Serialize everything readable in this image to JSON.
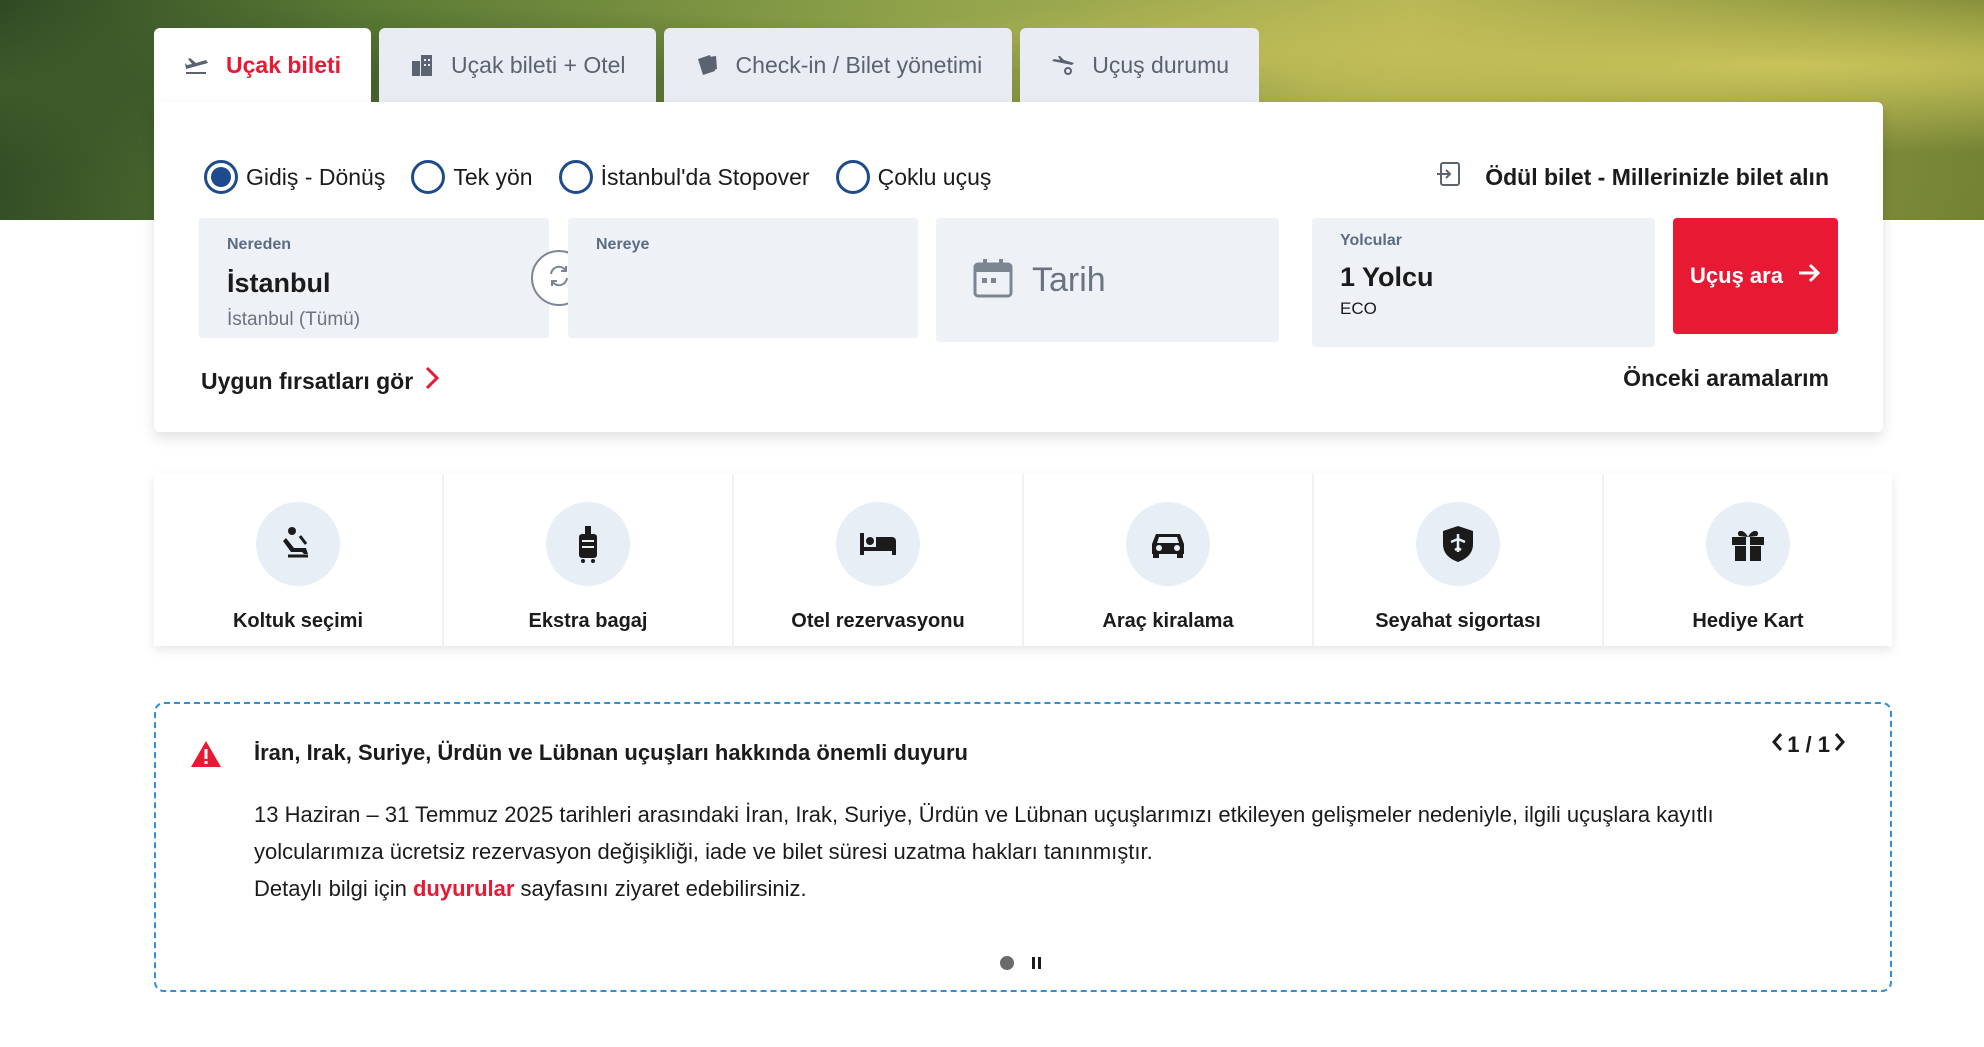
{
  "tabs": [
    {
      "label": "Uçak bileti",
      "icon": "plane-takeoff-icon",
      "active": true
    },
    {
      "label": "Uçak bileti + Otel",
      "icon": "hotel-building-icon",
      "active": false
    },
    {
      "label": "Check-in / Bilet yönetimi",
      "icon": "ticket-icon",
      "active": false
    },
    {
      "label": "Uçuş durumu",
      "icon": "flight-status-icon",
      "active": false
    }
  ],
  "trip_types": [
    {
      "label": "Gidiş - Dönüş",
      "selected": true
    },
    {
      "label": "Tek yön",
      "selected": false
    },
    {
      "label": "İstanbul'da Stopover",
      "selected": false
    },
    {
      "label": "Çoklu uçuş",
      "selected": false
    }
  ],
  "award": {
    "label": "Ödül bilet - Millerinizle bilet alın",
    "icon": "login-arrow-icon"
  },
  "from": {
    "label": "Nereden",
    "value": "İstanbul",
    "sub": "İstanbul (Tümü)"
  },
  "to": {
    "label": "Nereye",
    "value": ""
  },
  "date": {
    "placeholder": "Tarih",
    "icon": "calendar-icon"
  },
  "passengers": {
    "label": "Yolcular",
    "value": "1 Yolcu",
    "cabin": "ECO"
  },
  "search_button": {
    "label": "Uçuş ara",
    "icon": "arrow-right-icon"
  },
  "deals_link": {
    "label": "Uygun fırsatları gör",
    "icon": "chevron-right-icon"
  },
  "previous_searches": "Önceki aramalarım",
  "services": [
    {
      "label": "Koltuk seçimi",
      "icon": "seat-icon"
    },
    {
      "label": "Ekstra bagaj",
      "icon": "luggage-icon"
    },
    {
      "label": "Otel rezervasyonu",
      "icon": "bed-icon"
    },
    {
      "label": "Araç kiralama",
      "icon": "car-icon"
    },
    {
      "label": "Seyahat sigortası",
      "icon": "shield-plane-icon"
    },
    {
      "label": "Hediye Kart",
      "icon": "gift-icon"
    }
  ],
  "announcement": {
    "title": "İran, Irak, Suriye, Ürdün ve Lübnan uçuşları hakkında önemli duyuru",
    "pager": "1 / 1",
    "body_line1": "13 Haziran – 31 Temmuz 2025 tarihleri arasındaki İran, Irak, Suriye, Ürdün ve Lübnan uçuşlarımızı etkileyen gelişmeler nedeniyle, ilgili uçuşlara kayıtlı yolcularımıza ücretsiz rezervasyon değişikliği, iade ve bilet süresi uzatma hakları tanınmıştır.",
    "body_pre": "Detaylı bilgi için ",
    "body_link": "duyurular",
    "body_post": " sayfasını ziyaret edebilirsiniz."
  },
  "colors": {
    "brand_red": "#e81932",
    "radio_blue": "#1e4b8c",
    "field_bg": "#eef2f6",
    "dashed_border": "#2f8fd6"
  }
}
